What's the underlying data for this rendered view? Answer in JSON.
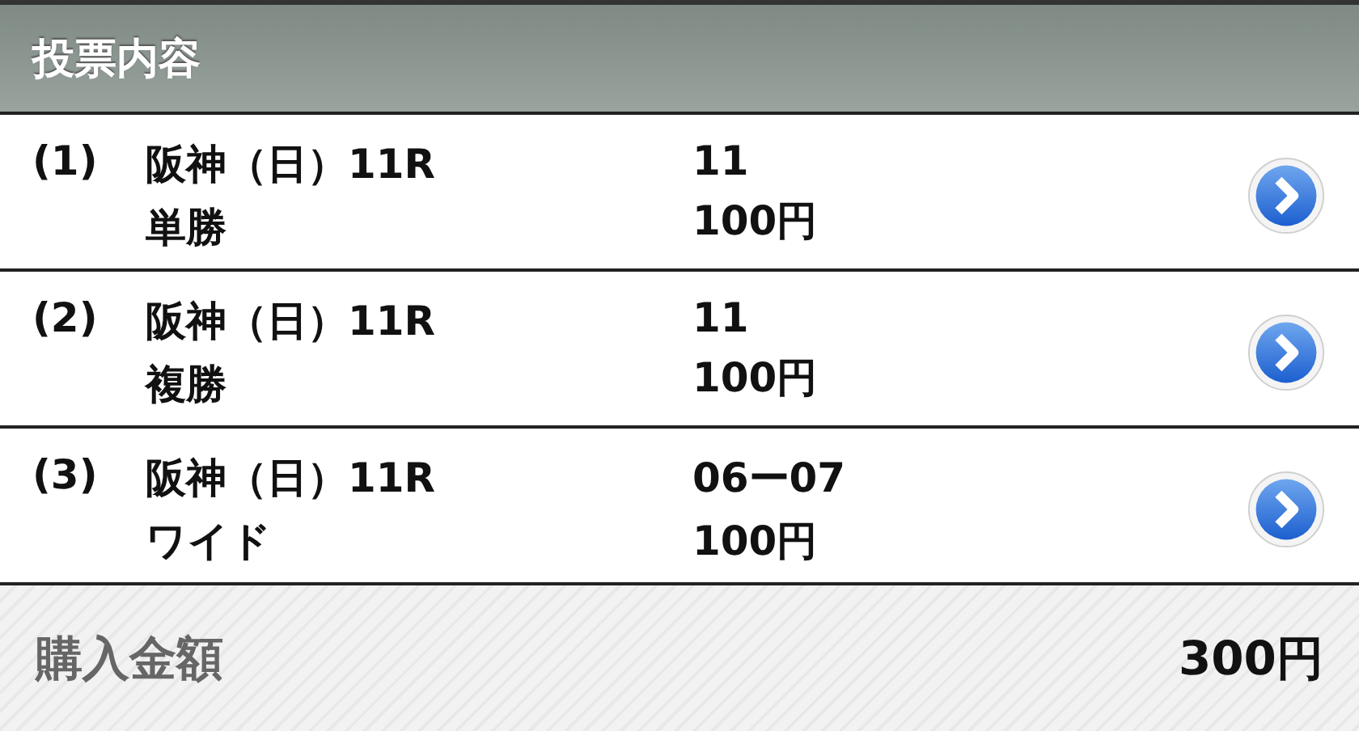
{
  "header": {
    "title": "投票内容"
  },
  "bets": [
    {
      "index": "(1)",
      "race": "阪神（日）11R",
      "type": "単勝",
      "selection": "11",
      "amount": "100円"
    },
    {
      "index": "(2)",
      "race": "阪神（日）11R",
      "type": "複勝",
      "selection": "11",
      "amount": "100円"
    },
    {
      "index": "(3)",
      "race": "阪神（日）11R",
      "type": "ワイド",
      "selection": "06ー07",
      "amount": "100円"
    }
  ],
  "total": {
    "label": "購入金額",
    "amount": "300円"
  }
}
